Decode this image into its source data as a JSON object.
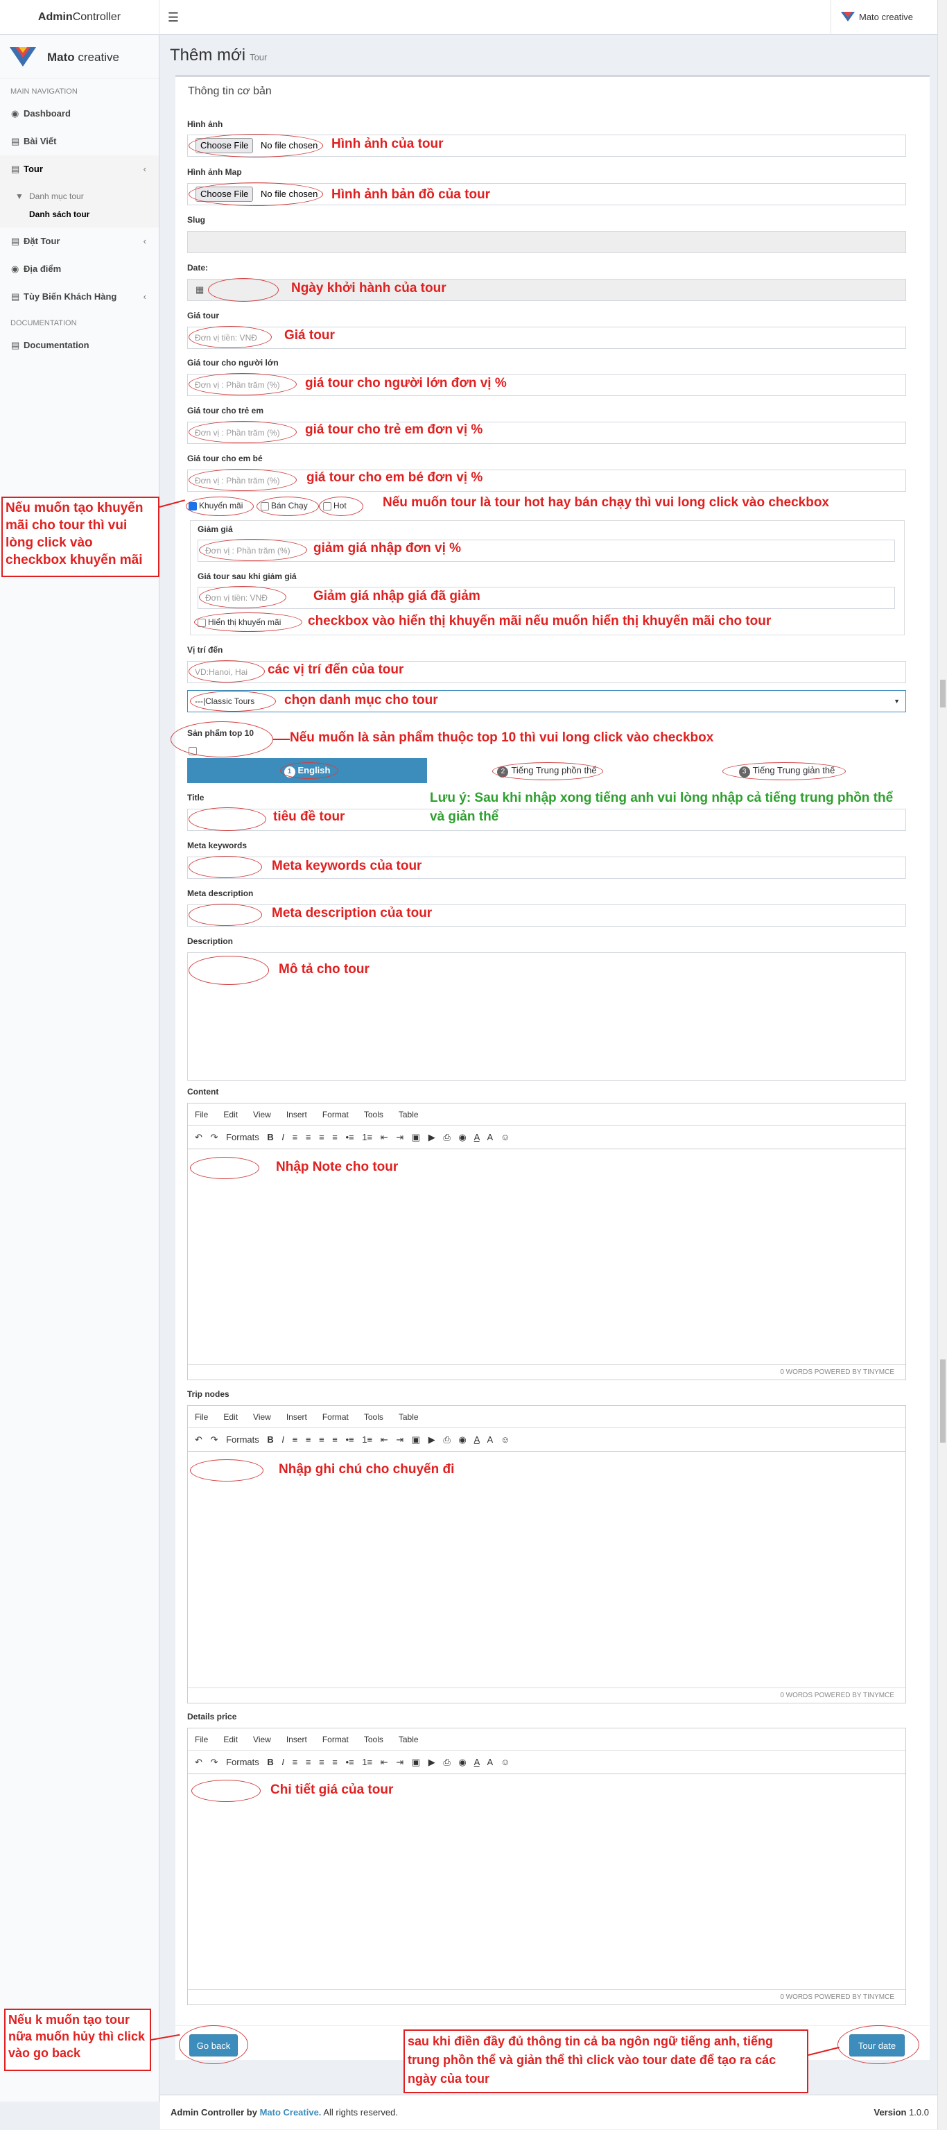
{
  "header": {
    "logo_bold": "Admin",
    "logo_rest": "Controller",
    "menu_icon": "hamburger-icon",
    "user_name": "Mato creative"
  },
  "sidebar": {
    "brand_bold": "Mato",
    "brand_rest": " creative",
    "main_nav": "MAIN NAVIGATION",
    "items": [
      {
        "label": "Dashboard",
        "icon": "dashboard-icon"
      },
      {
        "label": "Bài Viết",
        "icon": "list-icon"
      },
      {
        "label": "Tour",
        "icon": "list-icon"
      },
      {
        "label": "Danh mục tour",
        "icon": "filter-icon"
      },
      {
        "label": "Danh sách tour",
        "icon": "list-icon"
      },
      {
        "label": "Đặt Tour",
        "icon": "list-icon"
      },
      {
        "label": "Địa điểm",
        "icon": "globe-icon"
      },
      {
        "label": "Tùy Biến Khách Hàng",
        "icon": "list-icon"
      }
    ],
    "doc_head": "DOCUMENTATION",
    "doc_item": "Documentation"
  },
  "page": {
    "title": "Thêm mới",
    "subtitle": "Tour"
  },
  "form": {
    "section_title": "Thông tin cơ bản",
    "hinh_anh": "Hình ảnh",
    "choose_file": "Choose File",
    "no_file": "No file chosen",
    "hinh_anh_map": "Hình ảnh Map",
    "slug": "Slug",
    "date": "Date:",
    "gia_tour": "Giá tour",
    "gia_tour_ph": "Đơn vị tiền: VNĐ",
    "gia_nguoi_lon": "Giá tour cho người lớn",
    "gia_tre_em": "Giá tour cho trẻ em",
    "gia_em_be": "Giá tour cho em bé",
    "percent_ph": "Đơn vị : Phần trăm (%)",
    "khuyen_mai": "Khuyến mãi",
    "ban_chay": "Bán Chạy",
    "hot": "Hot",
    "giam_gia": "Giảm giá",
    "gia_sau_giam": "Giá tour sau khi giảm giá",
    "vnd_ph": "Đơn vị tiền: VNĐ",
    "hien_thi_km": "Hiển thị khuyến mãi",
    "vi_tri_den": "Vị trí đến",
    "vi_tri_ph": "VD:Hanoi, Hai",
    "danh_muc_value": "---|Classic Tours",
    "top10": "Sản phẩm top 10",
    "tab_en": "English",
    "tab_zh_t": "Tiếng Trung phồn thể",
    "tab_zh_s": "Tiếng Trung giản thể",
    "title": "Title",
    "meta_kw": "Meta keywords",
    "meta_desc": "Meta description",
    "description": "Description",
    "content": "Content",
    "trip_nodes": "Trip nodes",
    "details_price": "Details price",
    "go_back": "Go back",
    "tour_date": "Tour date"
  },
  "editor": {
    "menus": [
      "File",
      "Edit",
      "View",
      "Insert",
      "Format",
      "Tools",
      "Table"
    ],
    "formats": "Formats",
    "status": "0 WORDS POWERED BY TINYMCE"
  },
  "annotations": {
    "hinh_anh": "Hình ảnh của tour",
    "hinh_anh_map": "Hình ảnh bản đồ của tour",
    "date": "Ngày khởi hành của tour",
    "gia_tour": "Giá tour",
    "gia_nguoi_lon": "giá tour cho người lớn đơn vị %",
    "gia_tre_em": "giá tour cho trẻ em đơn vị %",
    "gia_em_be": "giá tour cho em bé đơn vị %",
    "hot": "Nếu muốn tour là tour hot hay bán chạy thì vui long click vào checkbox",
    "khuyen_mai_box": "Nếu muốn tạo khuyến mãi cho tour thì vui lòng click vào checkbox khuyến mãi",
    "giam_gia": "giảm giá nhập đơn vị %",
    "gia_sau_giam": "Giảm giá nhập giá đã giảm",
    "hien_thi": "checkbox vào hiển thị khuyến mãi nếu muốn hiển thị khuyến mãi cho tour",
    "vi_tri": "các vị trí đến của tour",
    "danh_muc": "chọn danh mục cho tour",
    "top10": "Nếu muốn là sản phẩm thuộc top 10 thì vui long click  vào checkbox",
    "luu_y": "Lưu ý: Sau khi nhập xong tiếng anh vui lòng nhập cả tiếng trung phồn thể và giản thể",
    "title": "tiêu đề tour",
    "meta_kw": "Meta keywords của tour",
    "meta_desc": "Meta description của tour",
    "desc": "Mô tả cho tour",
    "content": "Nhập Note cho tour",
    "trip": "Nhập ghi chú cho chuyến đi",
    "price": "Chi tiết giá của tour",
    "go_back": "Nếu k muốn tạo tour nữa muốn hủy thì click vào go back",
    "tour_date": "sau khi điền đầy đủ thông tin cả ba ngôn ngữ tiếng anh, tiếng trung phồn thể và giản thể thì click vào tour date để tạo ra các ngày của tour"
  },
  "footer": {
    "prefix": "Admin Controller by ",
    "link": "Mato Creative.",
    "suffix": " All rights reserved.",
    "version_label": "Version",
    "version": "1.0.0"
  }
}
